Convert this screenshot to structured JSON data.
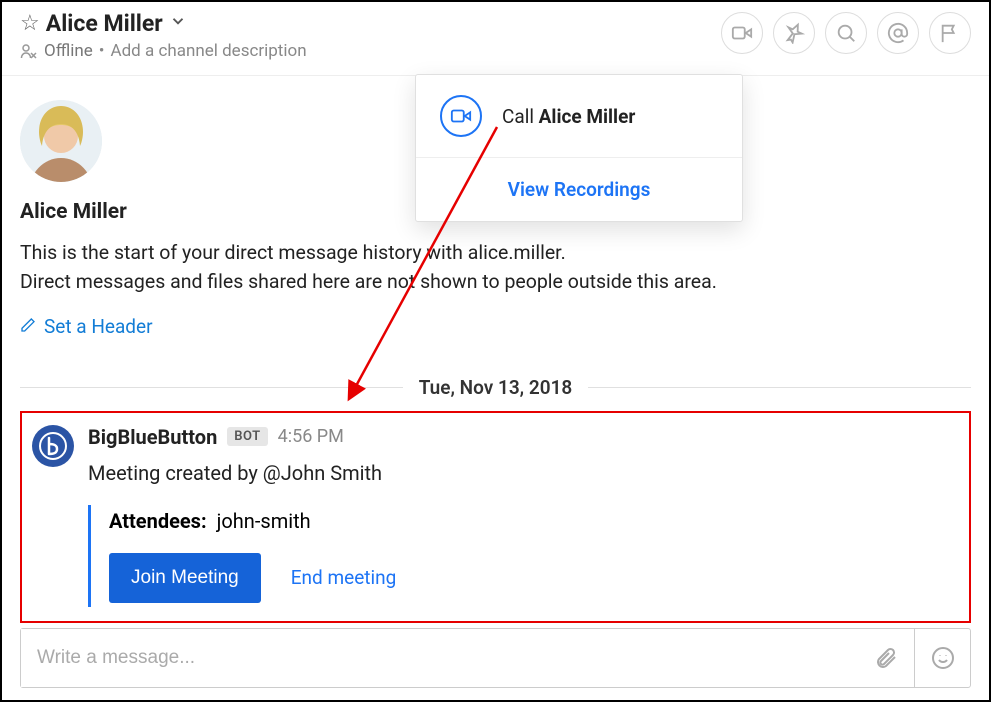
{
  "header": {
    "title": "Alice Miller",
    "presence": "Offline",
    "add_description": "Add a channel description"
  },
  "popover": {
    "call_prefix": "Call ",
    "call_name": "Alice Miller",
    "recordings": "View Recordings"
  },
  "intro": {
    "name": "Alice Miller",
    "line1": "This is the start of your direct message history with alice.miller.",
    "line2": "Direct messages and files shared here are not shown to people outside this area.",
    "set_header": "Set a Header"
  },
  "date_divider": "Tue, Nov 13, 2018",
  "message": {
    "author": "BigBlueButton",
    "bot_label": "BOT",
    "time": "4:56 PM",
    "text": "Meeting created by @John Smith",
    "attendees_label": "Attendees:",
    "attendees_value": "john-smith",
    "join_label": "Join Meeting",
    "end_label": "End meeting"
  },
  "composer": {
    "placeholder": "Write a message..."
  }
}
